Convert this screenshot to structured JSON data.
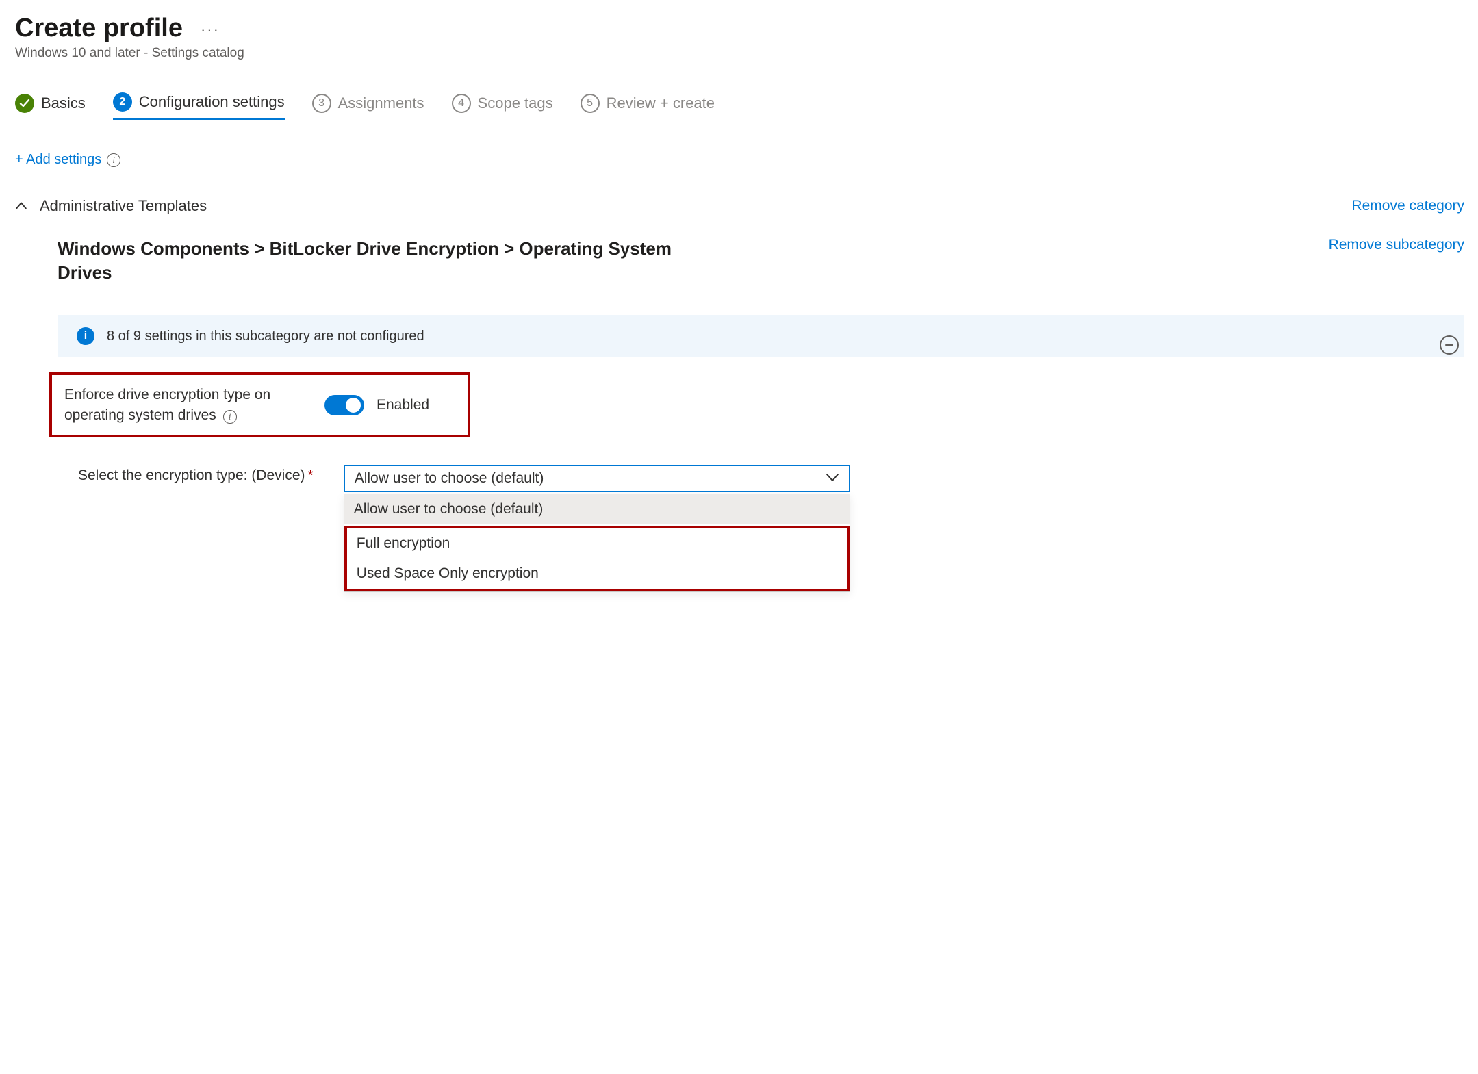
{
  "header": {
    "title": "Create profile",
    "subtitle": "Windows 10 and later - Settings catalog"
  },
  "stepper": [
    {
      "num": "",
      "label": "Basics",
      "state": "done"
    },
    {
      "num": "2",
      "label": "Configuration settings",
      "state": "active"
    },
    {
      "num": "3",
      "label": "Assignments",
      "state": "pending"
    },
    {
      "num": "4",
      "label": "Scope tags",
      "state": "pending"
    },
    {
      "num": "5",
      "label": "Review + create",
      "state": "pending"
    }
  ],
  "add_settings_label": "+ Add settings",
  "category": {
    "title": "Administrative Templates",
    "remove_label": "Remove category",
    "subcategory_path": "Windows Components > BitLocker Drive Encryption > Operating System Drives",
    "remove_subcategory_label": "Remove subcategory",
    "banner_text": "8 of 9 settings in this subcategory are not configured",
    "setting": {
      "label": "Enforce drive encryption type on operating system drives",
      "toggle_state": "Enabled"
    },
    "field": {
      "label": "Select the encryption type: (Device)",
      "required_marker": "*",
      "selected": "Allow user to choose (default)",
      "options": [
        "Allow user to choose (default)",
        "Full encryption",
        "Used Space Only encryption"
      ]
    }
  }
}
